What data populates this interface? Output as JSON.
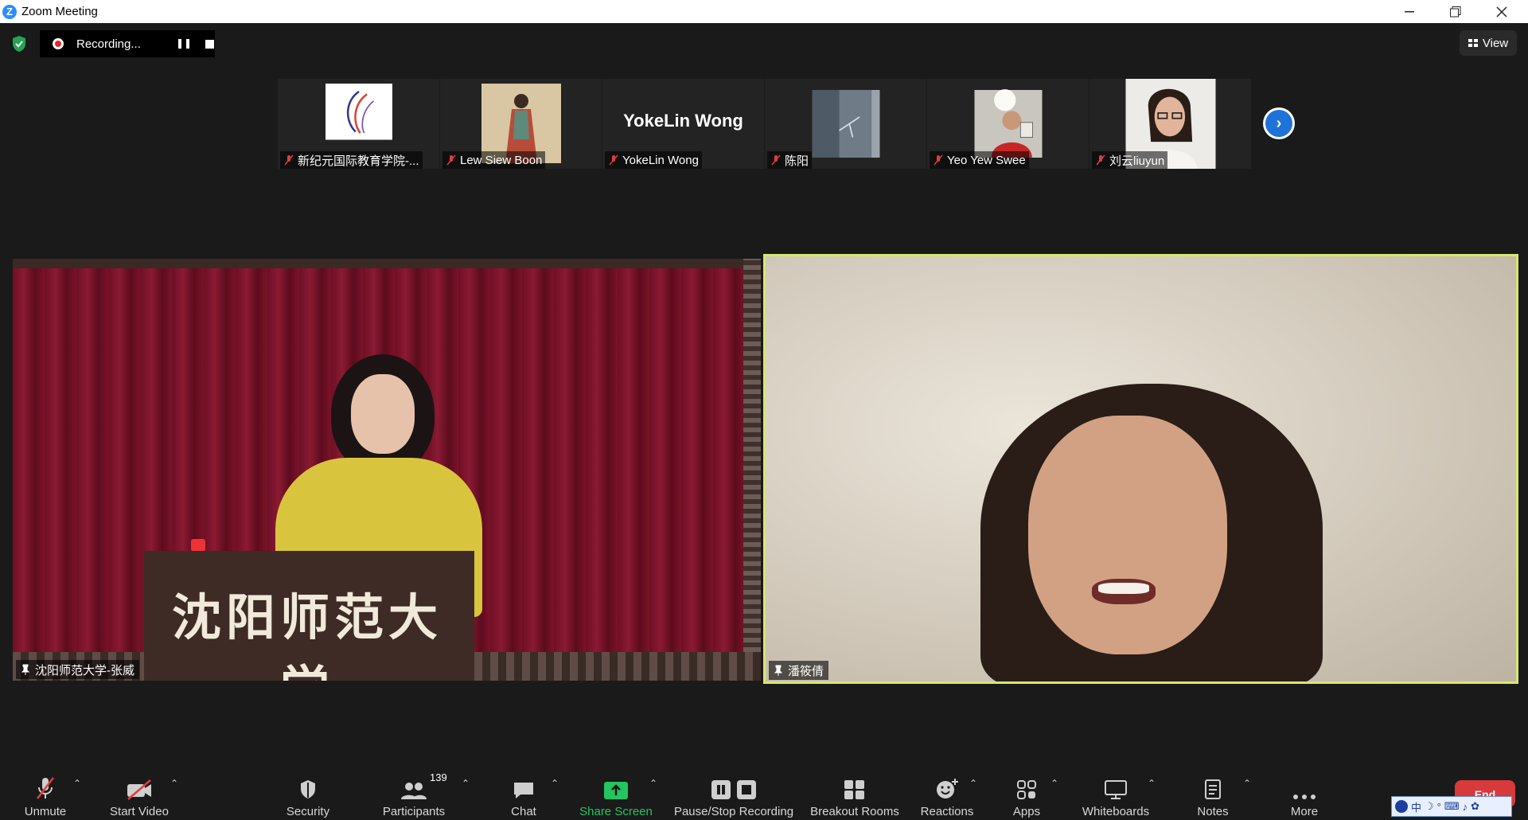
{
  "window": {
    "title": "Zoom Meeting",
    "app_icon": "Z"
  },
  "recording": {
    "status": "Recording...",
    "record_color": "#e02828"
  },
  "view": {
    "label": "View"
  },
  "thumbnails": [
    {
      "name": "新纪元国际教育学院-...",
      "pic": "logo"
    },
    {
      "name": "Lew Siew Boon",
      "pic": "painting"
    },
    {
      "name": "YokeLin Wong",
      "big": "YokeLin Wong"
    },
    {
      "name": "陈阳",
      "pic": "ceiling"
    },
    {
      "name": "Yeo Yew Swee",
      "pic": "man"
    },
    {
      "name": "刘云liuyun",
      "pic": "woman"
    }
  ],
  "tiles": {
    "left": {
      "name": "沈阳师范大学-张威",
      "podium_text": "沈阳师范大学"
    },
    "right": {
      "name": "潘筱倩",
      "active_border": "#d7e86e"
    }
  },
  "toolbar": {
    "unmute": "Unmute",
    "start_video": "Start Video",
    "security": "Security",
    "participants": "Participants",
    "participants_count": "139",
    "chat": "Chat",
    "share_screen": "Share Screen",
    "pause_stop_recording": "Pause/Stop Recording",
    "breakout_rooms": "Breakout Rooms",
    "reactions": "Reactions",
    "apps": "Apps",
    "whiteboards": "Whiteboards",
    "notes": "Notes",
    "more": "More",
    "end": "End",
    "share_color": "#22c55e",
    "end_color": "#d63a3a"
  },
  "ime": {
    "text": "中"
  }
}
